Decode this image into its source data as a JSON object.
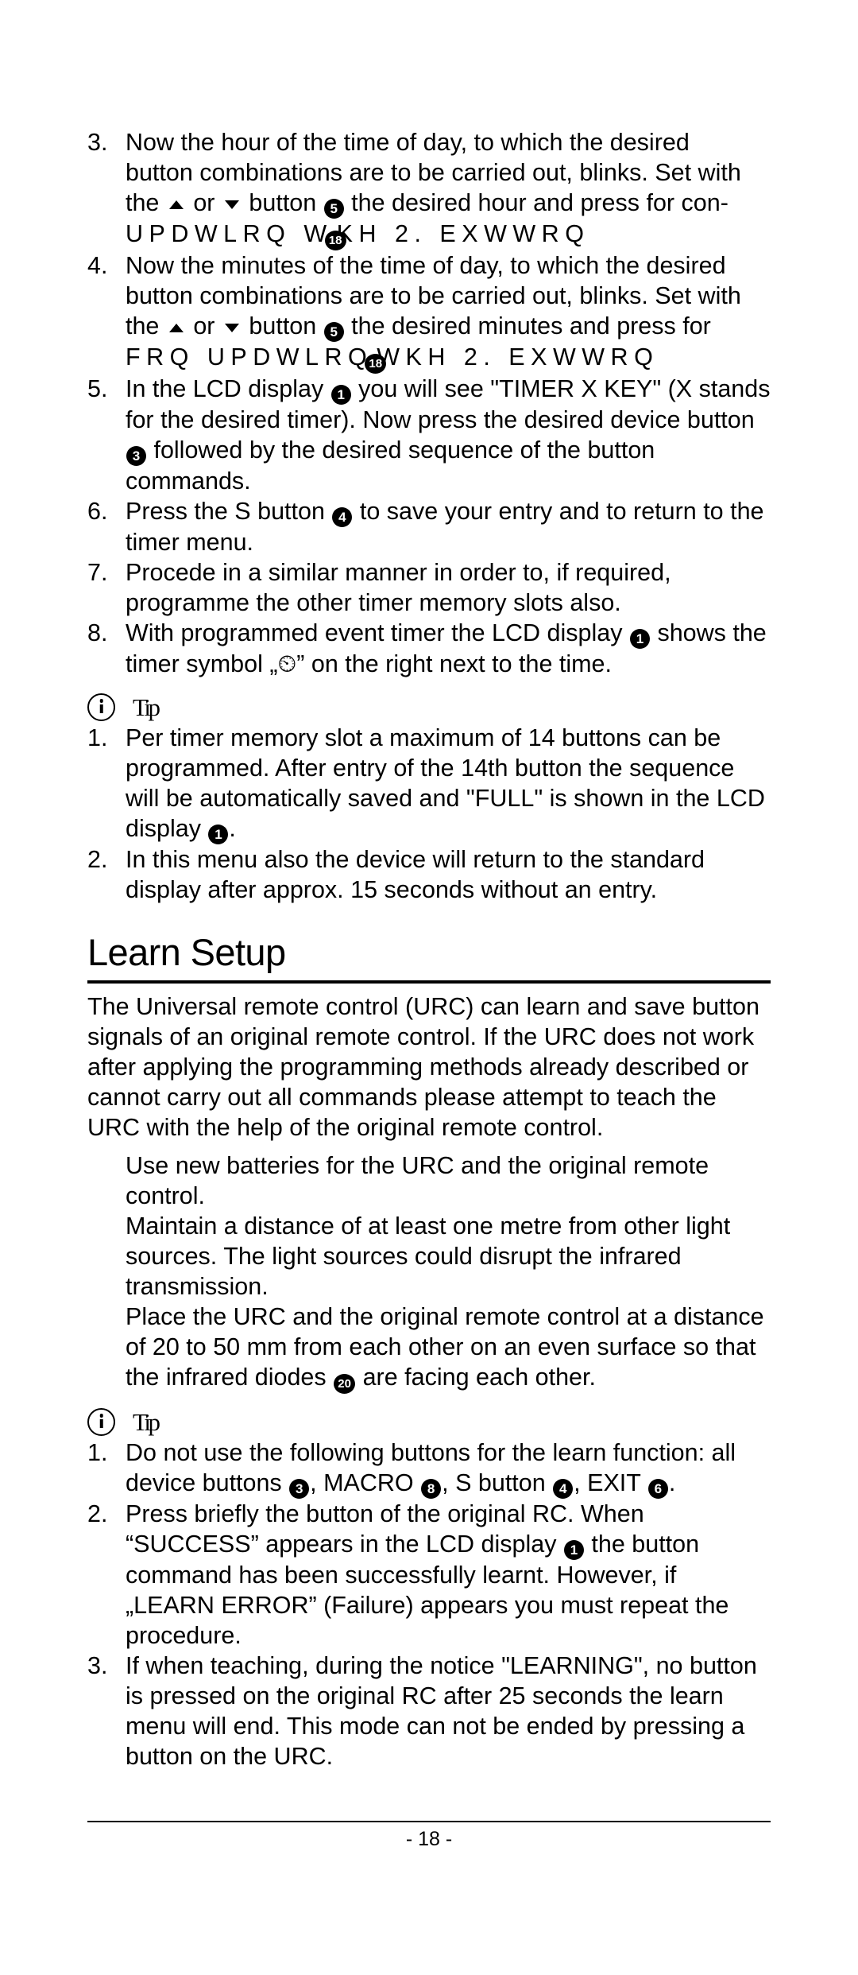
{
  "page": {
    "number_label": "- 18 -"
  },
  "procedure": {
    "items": [
      {
        "number": "3.",
        "line1_a": "Now the hour of the time of day, to which the desired",
        "line2": "button combinations are to be carried out, blinks. Set with",
        "line3_a": "the ",
        "line3_b": " or ",
        "line3_c": " button ",
        "line3_marker": "5",
        "line3_d": " the desired hour and press for con-",
        "garbled_line": "UPDWLRQ W",
        "garbled_marker": "18",
        "garbled_rest": "KH 2. EXWWRQ"
      },
      {
        "number": "4.",
        "line1": "Now the minutes of the time of day, to which the desired",
        "line2": "button combinations are to be carried out, blinks. Set with",
        "line3_a": "the ",
        "line3_b": " or ",
        "line3_c": " button ",
        "line3_marker": "5",
        "line3_d": " the desired minutes and press for",
        "garbled_line": "FRQ UPDWLRQ",
        "garbled_marker": "18",
        "garbled_rest": "WKH 2. EXWWRQ"
      },
      {
        "number": "5.",
        "part_a": "In the LCD display ",
        "marker_1": "1",
        "part_b": " you will see \"TIMER X KEY\" (X stands for the desired timer). Now press the desired device button ",
        "marker_2": "3",
        "part_c": " followed by the desired sequence of the button commands."
      },
      {
        "number": "6.",
        "part_a": "Press the S button ",
        "marker_1": "4",
        "part_b": " to save your entry and to return to the timer menu."
      },
      {
        "number": "7.",
        "part_a": "Procede in a similar manner in order to, if required, programme the other timer memory slots also."
      },
      {
        "number": "8.",
        "part_a": "With programmed event timer the LCD display ",
        "marker_1": "1",
        "part_b": " shows the timer symbol „⏲” on the right next to the time."
      }
    ]
  },
  "tip_one": {
    "icon": "info-icon",
    "label": "Tip",
    "items": [
      {
        "number": "1.",
        "part_a": "Per timer memory slot a maximum of 14 buttons can be programmed. After entry of the 14th button the sequence will be automatically saved and \"FULL\" is shown in the LCD display ",
        "marker_1": "1",
        "part_b": "."
      },
      {
        "number": "2.",
        "part_a": "In this menu also the device will return to the standard display after approx. 15 seconds without an entry."
      }
    ]
  },
  "learn_setup": {
    "heading": "Learn Setup",
    "intro": "The Universal remote control (URC) can learn and save button signals of an original remote control. If the URC does not work after applying the programming methods already described or cannot carry out all commands please attempt to teach the URC with the help of the original remote control.",
    "notes": [
      "Use new batteries for the URC and the original remote control.",
      "Maintain a distance of at least one metre from other light sources. The light sources could disrupt the infrared transmission."
    ],
    "note_with_marker": {
      "part_a": "Place the URC and the original remote control at a distance of 20 to 50 mm from each other on an even surface so that the infrared diodes ",
      "marker_1": "20",
      "part_b": " are facing each other."
    }
  },
  "tip_two": {
    "icon": "info-icon",
    "label": "Tip",
    "items": [
      {
        "number": "1.",
        "part_a": "Do not use the following buttons for the learn function: all device buttons ",
        "marker_1": "3",
        "part_b": ", MACRO ",
        "marker_2": "8",
        "part_c": ", S button ",
        "marker_3": "4",
        "part_d": ", EXIT ",
        "marker_4": "6",
        "part_e": "."
      },
      {
        "number": "2.",
        "part_a": "Press briefly the button of the original RC. When “SUCCESS” appears in the LCD display ",
        "marker_1": "1",
        "part_b": " the button command has been successfully learnt. However, if „LEARN ERROR” (Failure) appears you must repeat the procedure."
      },
      {
        "number": "3.",
        "part_a": "If when teaching, during the notice \"LEARNING\", no button is pressed on the original RC after 25 seconds the learn menu will end. This mode can not be ended by pressing a button on the URC."
      }
    ]
  },
  "colors": {
    "text": "#000000",
    "background": "#ffffff",
    "marker_fill": "#000000",
    "marker_text": "#ffffff"
  }
}
